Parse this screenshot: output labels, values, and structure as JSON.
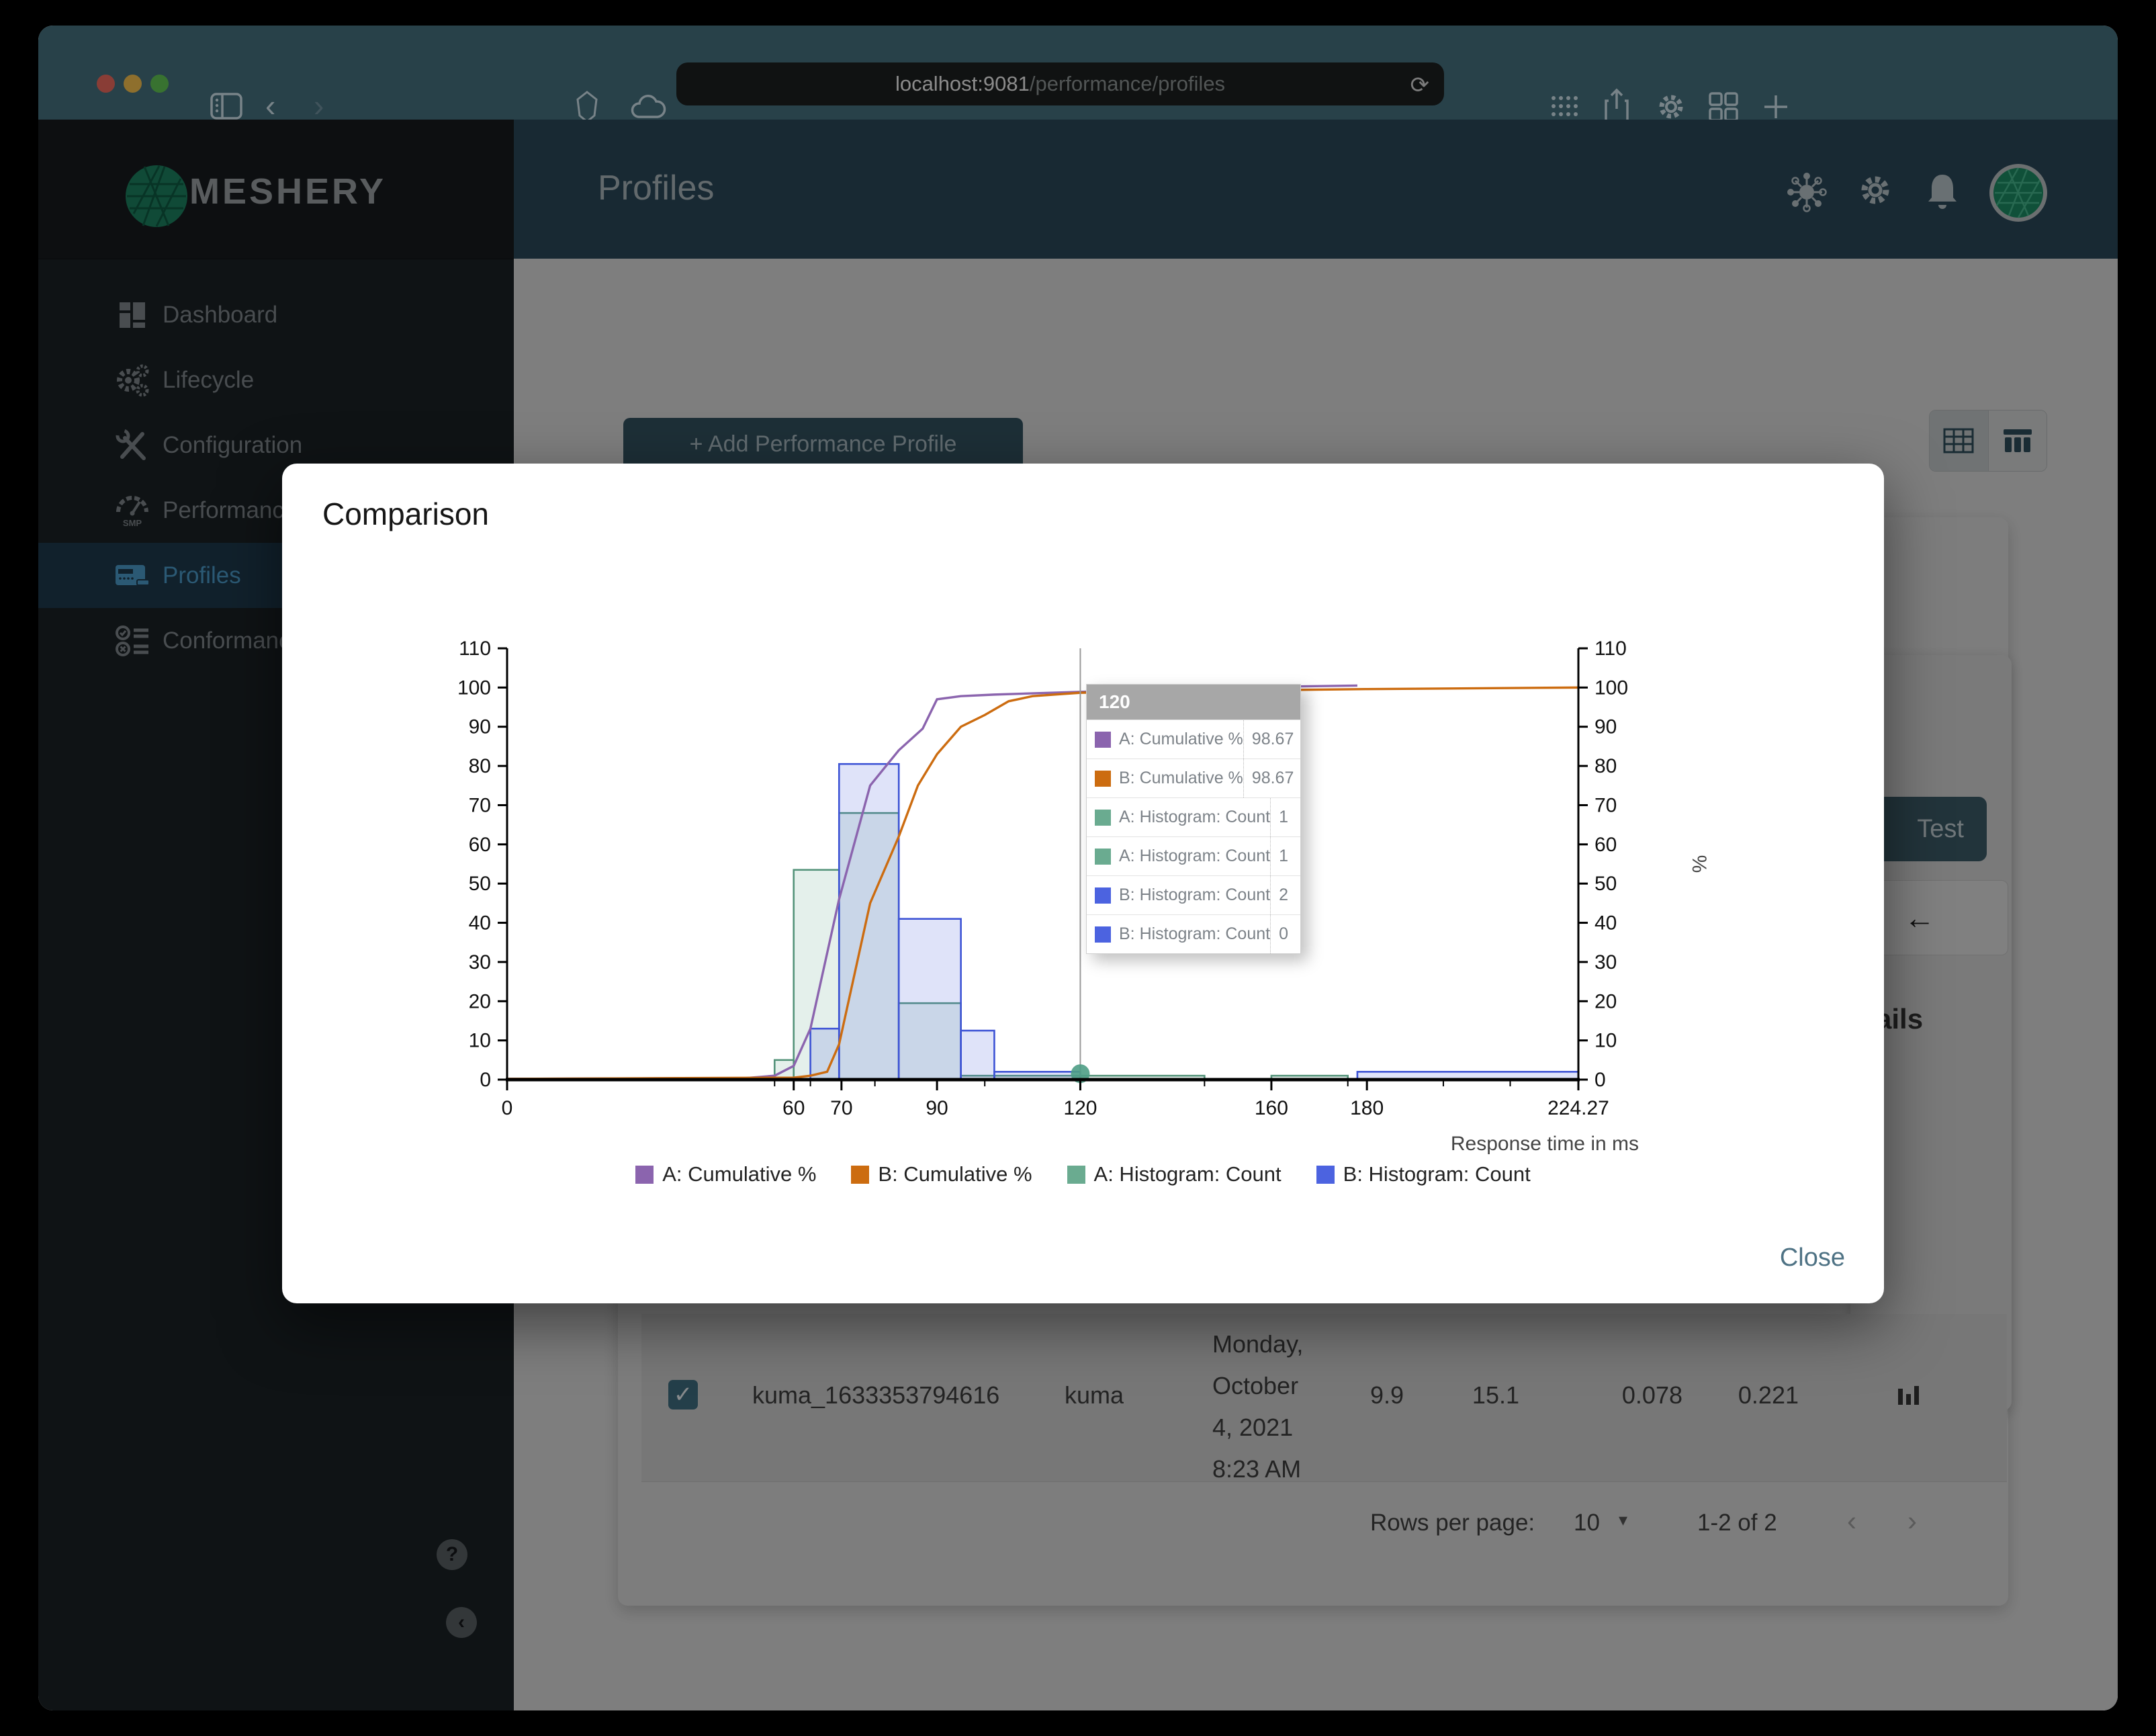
{
  "colors": {
    "purple": "#8b64ae",
    "orange": "#cc6c10",
    "green_stroke": "#54937a",
    "green": "#6aab90",
    "blue": "#4c63e0",
    "blue_stroke": "#3d53d5",
    "titlebar": "#45707f",
    "header": "#2a4858",
    "sidebar_active": "#4b9ac9",
    "hover_dot": "#4e9d85"
  },
  "browser": {
    "host": "localhost:9081",
    "path": "/performance/profiles",
    "toolbar_icons": [
      "sidebar-toggle-icon",
      "back-icon",
      "forward-icon",
      "shield-icon",
      "cloud-icon",
      "reload-icon",
      "grid-icon",
      "share-icon",
      "settings-icon",
      "tiles-icon",
      "new-tab-icon"
    ],
    "back_glyph": "‹",
    "forward_glyph": "›",
    "reload_glyph": "⟳"
  },
  "sidebar": {
    "brand": "MESHERY",
    "items": [
      {
        "label": "Dashboard",
        "icon": "dashboard-icon",
        "active": false
      },
      {
        "label": "Lifecycle",
        "icon": "lifecycle-icon",
        "active": false
      },
      {
        "label": "Configuration",
        "icon": "configuration-icon",
        "active": false
      },
      {
        "label": "Performance",
        "icon": "performance-icon",
        "active": false
      },
      {
        "label": "Profiles",
        "icon": "profiles-icon",
        "active": true
      },
      {
        "label": "Conformance",
        "icon": "conformance-icon",
        "active": false
      }
    ],
    "help_glyph": "?",
    "collapse_glyph": "‹"
  },
  "header": {
    "title": "Profiles",
    "icons": [
      "adapters-icon",
      "settings-icon",
      "notifications-icon",
      "avatar"
    ]
  },
  "content": {
    "add_profile_button": "+ Add Performance Profile",
    "test_button": "Test",
    "back_arrow": "←",
    "details_heading_visible": "ails",
    "row": {
      "checked": true,
      "check_glyph": "✓",
      "name": "kuma_1633353794616",
      "mesh": "kuma",
      "date_lines": [
        "Monday,",
        "October",
        "4, 2021",
        "8:23 AM"
      ],
      "qps": "9.9",
      "duration": "15.1",
      "p50": "0.078",
      "p99": "0.221"
    },
    "pagination": {
      "label": "Rows per page:",
      "value": "10",
      "caret": "▾",
      "range": "1-2 of 2",
      "prev_glyph": "‹",
      "next_glyph": "›"
    }
  },
  "modal": {
    "title": "Comparison",
    "close": "Close",
    "tooltip": {
      "title": "120",
      "rows": [
        {
          "swatch": "#8b64ae",
          "label": "A: Cumulative %",
          "value": "98.67"
        },
        {
          "swatch": "#cc6c10",
          "label": "B: Cumulative %",
          "value": "98.67"
        },
        {
          "swatch": "#6aab90",
          "label": "A: Histogram: Count",
          "value": "1"
        },
        {
          "swatch": "#6aab90",
          "label": "A: Histogram: Count",
          "value": "1"
        },
        {
          "swatch": "#4c63e0",
          "label": "B: Histogram: Count",
          "value": "2"
        },
        {
          "swatch": "#4c63e0",
          "label": "B: Histogram: Count",
          "value": "0"
        }
      ]
    }
  },
  "chart_data": {
    "type": "combo-histogram-cumulative",
    "xlabel": "Response time in ms",
    "y_right_label": "%",
    "xlim": [
      0,
      224.27
    ],
    "ylim": [
      0,
      110
    ],
    "x_ticks": [
      0,
      60,
      70,
      90,
      120,
      160,
      180,
      224.27
    ],
    "x_minor_ticks": [
      56,
      63.5,
      77,
      100,
      146,
      176,
      196,
      210
    ],
    "y_ticks": [
      0,
      10,
      20,
      30,
      40,
      50,
      60,
      70,
      80,
      90,
      100,
      110
    ],
    "grid": false,
    "legend_position": "bottom",
    "hover": {
      "x": 120,
      "dot_y": 1.5
    },
    "series": [
      {
        "name": "A: Cumulative %",
        "type": "line",
        "color": "#8b64ae",
        "points": [
          [
            0,
            0.2
          ],
          [
            50,
            0.4
          ],
          [
            56,
            1
          ],
          [
            60,
            3.5
          ],
          [
            63.5,
            13
          ],
          [
            69.5,
            46
          ],
          [
            76,
            75
          ],
          [
            82,
            84
          ],
          [
            87,
            89.5
          ],
          [
            90,
            97
          ],
          [
            95,
            97.8
          ],
          [
            102,
            98.2
          ],
          [
            120,
            98.9
          ],
          [
            146,
            99.8
          ],
          [
            160,
            100.2
          ],
          [
            178,
            100.5
          ]
        ]
      },
      {
        "name": "B: Cumulative %",
        "type": "line",
        "color": "#cc6c10",
        "points": [
          [
            0,
            0.2
          ],
          [
            60,
            0.5
          ],
          [
            63.5,
            1
          ],
          [
            67,
            2
          ],
          [
            69.5,
            9
          ],
          [
            76,
            45
          ],
          [
            82,
            62
          ],
          [
            86,
            75
          ],
          [
            90,
            83
          ],
          [
            95,
            90
          ],
          [
            100,
            93
          ],
          [
            105,
            96.5
          ],
          [
            110,
            97.8
          ],
          [
            120,
            98.67
          ],
          [
            150,
            99.2
          ],
          [
            180,
            99.6
          ],
          [
            224.27,
            100
          ]
        ]
      },
      {
        "name": "A: Histogram: Count",
        "type": "histogram",
        "color": "#54937a",
        "fill": "#6aab90",
        "bins": [
          [
            56,
            60,
            5
          ],
          [
            60,
            69.5,
            53.5
          ],
          [
            69.5,
            82,
            68
          ],
          [
            82,
            95,
            19.5
          ],
          [
            95,
            120,
            1
          ],
          [
            120,
            146,
            1
          ],
          [
            160,
            176,
            1
          ]
        ]
      },
      {
        "name": "B: Histogram: Count",
        "type": "histogram",
        "color": "#3d53d5",
        "fill": "#4c63e0",
        "bins": [
          [
            63.5,
            69.5,
            13
          ],
          [
            69.5,
            82,
            80.5
          ],
          [
            82,
            95,
            41
          ],
          [
            95,
            102,
            12.5
          ],
          [
            102,
            120,
            2
          ],
          [
            178,
            224.27,
            2
          ]
        ]
      }
    ]
  }
}
